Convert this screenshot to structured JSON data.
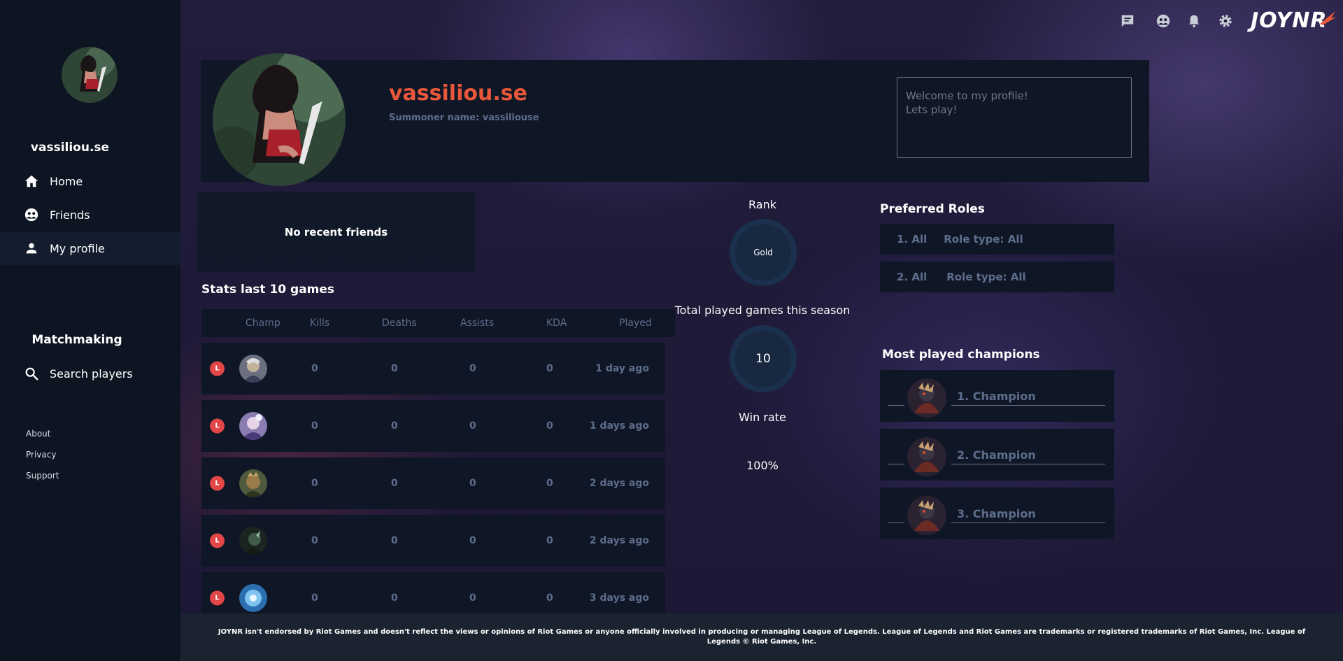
{
  "sidebar": {
    "username": "vassiliou.se",
    "nav": [
      {
        "label": "Home",
        "icon": "home-icon"
      },
      {
        "label": "Friends",
        "icon": "friends-icon"
      },
      {
        "label": "My profile",
        "icon": "user-icon"
      }
    ],
    "matchmaking_heading": "Matchmaking",
    "search_label": "Search players",
    "footer_links": [
      "About",
      "Privacy",
      "Support"
    ]
  },
  "topbar": {
    "icons": [
      "chat-icon",
      "friends-icon",
      "bell-icon",
      "gear-icon"
    ],
    "logo_text": "JOYNR"
  },
  "profile": {
    "display_name": "vassiliou.se",
    "summoner_name": "Summoner name: vassiliouse",
    "bio": "Welcome to my profile!\nLets play!"
  },
  "recent_friends": {
    "empty_text": "No recent friends"
  },
  "stats": {
    "title": "Stats last 10 games",
    "columns": [
      "Champ",
      "Kills",
      "Deaths",
      "Assists",
      "KDA",
      "Played"
    ],
    "rows": [
      {
        "result": "L",
        "kills": "0",
        "deaths": "0",
        "assists": "0",
        "kda": "0",
        "played": "1 day ago"
      },
      {
        "result": "L",
        "kills": "0",
        "deaths": "0",
        "assists": "0",
        "kda": "0",
        "played": "1 days ago"
      },
      {
        "result": "L",
        "kills": "0",
        "deaths": "0",
        "assists": "0",
        "kda": "0",
        "played": "2 days ago"
      },
      {
        "result": "L",
        "kills": "0",
        "deaths": "0",
        "assists": "0",
        "kda": "0",
        "played": "2 days ago"
      },
      {
        "result": "L",
        "kills": "0",
        "deaths": "0",
        "assists": "0",
        "kda": "0",
        "played": "3 days ago"
      }
    ]
  },
  "summary": {
    "rank_label": "Rank",
    "rank_value": "Gold",
    "games_label": "Total played games this season",
    "games_value": "10",
    "winrate_label": "Win rate",
    "winrate_value": "100%"
  },
  "preferred_roles": {
    "title": "Preferred Roles",
    "roles": [
      {
        "rank": "1. All",
        "type": "Role type: All"
      },
      {
        "rank": "2. All",
        "type": "Role type: All"
      }
    ]
  },
  "most_played": {
    "title": "Most played champions",
    "champions": [
      "1. Champion",
      "2. Champion",
      "3. Champion"
    ]
  },
  "footer": {
    "disclaimer": "JOYNR isn't endorsed by Riot Games and doesn't reflect the views or opinions of Riot Games or anyone officially involved in producing or managing League of Legends. League of Legends and Riot Games are trademarks or registered trademarks of Riot Games, Inc. League of Legends © Riot Games, Inc."
  },
  "colors": {
    "accent": "#e8573a",
    "loss_badge": "#e34646",
    "muted_text": "#5d6d8c",
    "card_bg": "#0f1726"
  }
}
